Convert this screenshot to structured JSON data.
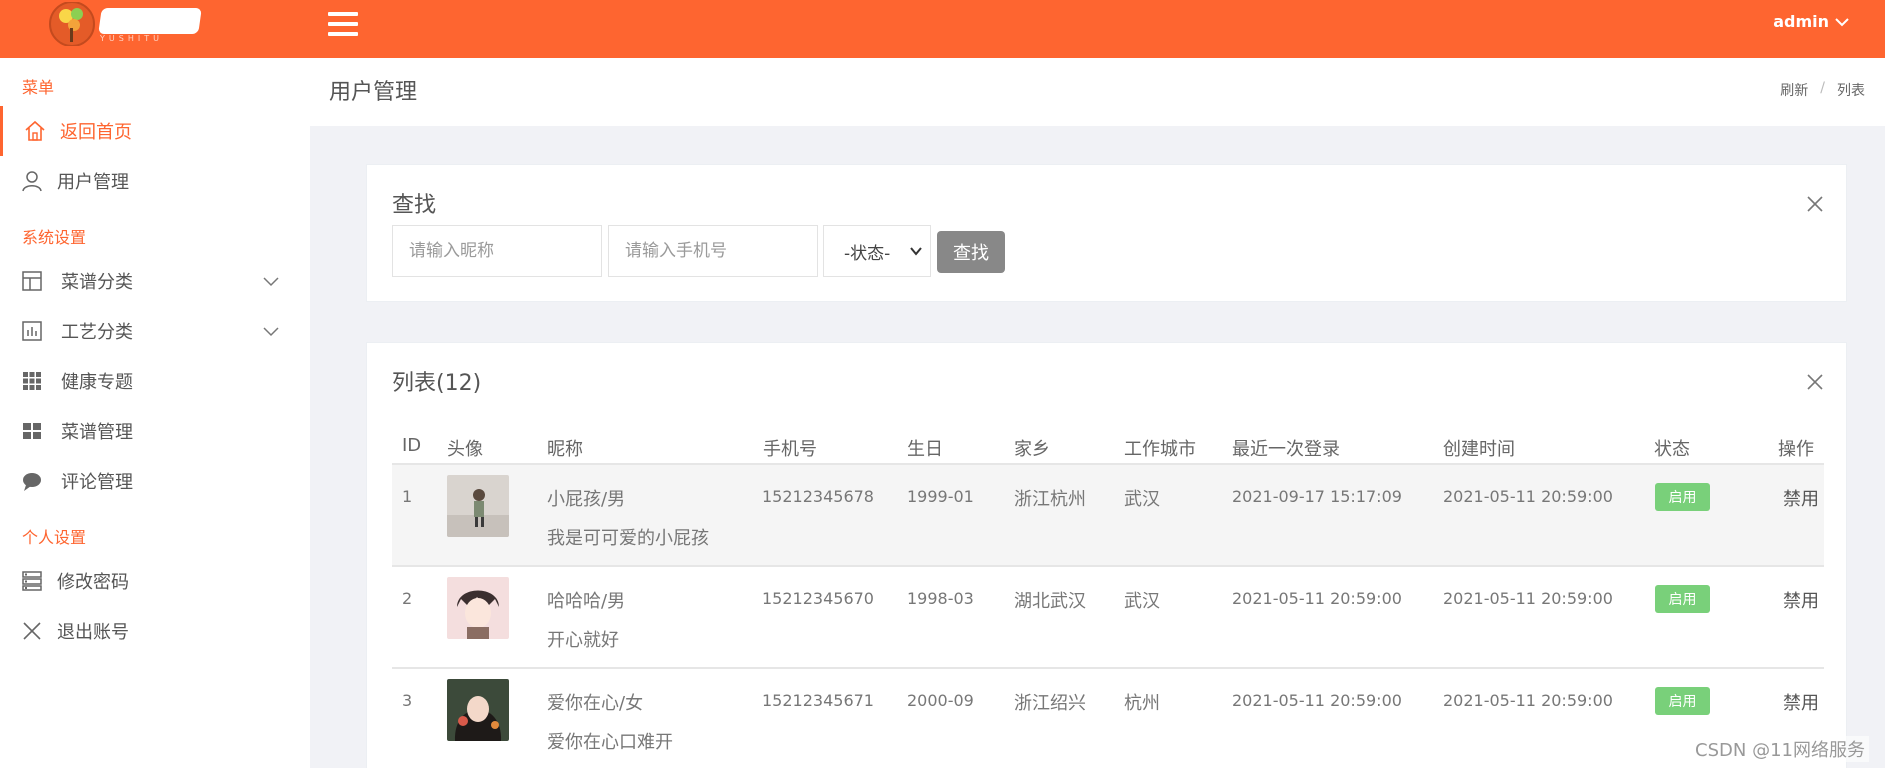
{
  "header": {
    "logo_sub": "YUSHITU",
    "user": "admin"
  },
  "sidebar": {
    "section_menu": "菜单",
    "section_system": "系统设置",
    "section_personal": "个人设置",
    "items": [
      {
        "label": "返回首页",
        "icon": "home-icon"
      },
      {
        "label": "用户管理",
        "icon": "user-icon"
      },
      {
        "label": "菜谱分类",
        "icon": "layout-icon"
      },
      {
        "label": "工艺分类",
        "icon": "chart-icon"
      },
      {
        "label": "健康专题",
        "icon": "grid-icon"
      },
      {
        "label": "菜谱管理",
        "icon": "tiles-icon"
      },
      {
        "label": "评论管理",
        "icon": "comment-icon"
      },
      {
        "label": "修改密码",
        "icon": "list-icon"
      },
      {
        "label": "退出账号",
        "icon": "close-icon"
      }
    ]
  },
  "page": {
    "title": "用户管理",
    "breadcrumb": [
      "刷新",
      "列表"
    ]
  },
  "search": {
    "title": "查找",
    "nickname_placeholder": "请输入昵称",
    "phone_placeholder": "请输入手机号",
    "status_selected": "-状态-",
    "button": "查找"
  },
  "list": {
    "title": "列表(12)",
    "columns": [
      "ID",
      "头像",
      "昵称",
      "手机号",
      "生日",
      "家乡",
      "工作城市",
      "最近一次登录",
      "创建时间",
      "状态",
      "操作"
    ],
    "rows": [
      {
        "id": "1",
        "nick": "小屁孩/男",
        "bio": "我是可可爱的小屁孩",
        "phone": "15212345678",
        "birthday": "1999-01",
        "hometown": "浙江杭州",
        "city": "武汉",
        "last_login": "2021-09-17 15:17:09",
        "created": "2021-05-11 20:59:00",
        "status": "启用",
        "action": "禁用"
      },
      {
        "id": "2",
        "nick": "哈哈哈/男",
        "bio": "开心就好",
        "phone": "15212345670",
        "birthday": "1998-03",
        "hometown": "湖北武汉",
        "city": "武汉",
        "last_login": "2021-05-11 20:59:00",
        "created": "2021-05-11 20:59:00",
        "status": "启用",
        "action": "禁用"
      },
      {
        "id": "3",
        "nick": "爱你在心/女",
        "bio": "爱你在心口难开",
        "phone": "15212345671",
        "birthday": "2000-09",
        "hometown": "浙江绍兴",
        "city": "杭州",
        "last_login": "2021-05-11 20:59:00",
        "created": "2021-05-11 20:59:00",
        "status": "启用",
        "action": "禁用"
      }
    ]
  },
  "watermark": "CSDN @11网络服务",
  "colors": {
    "accent": "#fe6530",
    "badge": "#79d07a",
    "button": "#888888"
  }
}
